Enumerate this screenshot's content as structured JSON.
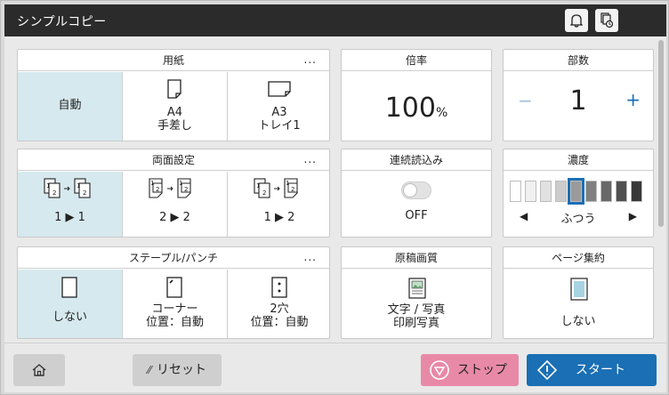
{
  "title": "シンプルコピー",
  "paper": {
    "header": "用紙",
    "more": "...",
    "auto": "自動",
    "opt1_size": "A4",
    "opt1_tray": "手差し",
    "opt2_size": "A3",
    "opt2_tray": "トレイ1"
  },
  "ratio": {
    "header": "倍率",
    "value": "100",
    "unit": "%"
  },
  "copies": {
    "header": "部数",
    "value": "1",
    "minus": "−",
    "plus": "+"
  },
  "duplex": {
    "header": "両面設定",
    "more": "...",
    "opt1": "1 ▶ 1",
    "opt2": "2 ▶ 2",
    "opt3": "1 ▶ 2"
  },
  "continuous": {
    "header": "連続読込み",
    "state": "OFF"
  },
  "density": {
    "header": "濃度",
    "label": "ふつう",
    "left": "◀",
    "right": "▶",
    "level": 5,
    "steps": 9
  },
  "staple": {
    "header": "ステープル/パンチ",
    "more": "...",
    "none": "しない",
    "corner_l1": "コーナー",
    "corner_l2": "位置：自動",
    "punch_l1": "2穴",
    "punch_l2": "位置：自動"
  },
  "quality": {
    "header": "原稿画質",
    "l1": "文字 / 写真",
    "l2": "印刷写真"
  },
  "combine": {
    "header": "ページ集約",
    "value": "しない"
  },
  "footer": {
    "reset": "リセット",
    "stop": "ストップ",
    "start": "スタート"
  },
  "colors": {
    "accent": "#1a6fb5",
    "selected": "#d6e9ee",
    "stop": "#e889a8",
    "titlebar": "#2b2b2b"
  }
}
